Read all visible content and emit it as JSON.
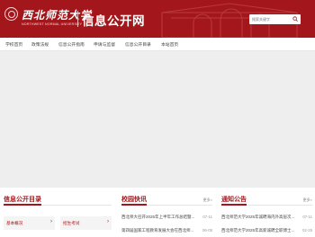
{
  "header": {
    "logo_cn": "西北师范大学",
    "logo_en": "NORTHWEST NORMAL UNIVERSITY",
    "site_title": "信息公开网",
    "search_placeholder": "搜索关键字"
  },
  "nav": {
    "items": [
      {
        "label": "学校首页"
      },
      {
        "label": "政策法规"
      },
      {
        "label": "信息公开指南"
      },
      {
        "label": "申请与监督"
      },
      {
        "label": "信息公开目录"
      },
      {
        "label": "本站首页"
      }
    ]
  },
  "sections": {
    "directory": {
      "title": "信息公开目录",
      "categories": [
        {
          "label": "基本概况"
        },
        {
          "label": "招生考试"
        }
      ]
    },
    "campus_news": {
      "title": "校园快讯",
      "more": "更多>",
      "items": [
        {
          "title": "西北师大召开2025年上半年工作总结暨...",
          "date": "07-11"
        },
        {
          "title": "第四届国家工程教育发展大会在西北师...",
          "date": "06-05"
        }
      ]
    },
    "notices": {
      "title": "通知公告",
      "more": "更多>",
      "items": [
        {
          "title": "西北师范大学2025年诚聘海内外高层次...",
          "date": "07-11"
        },
        {
          "title": "西北师范大学2025年高新诚聘全职博士...",
          "date": "02-25"
        }
      ]
    }
  },
  "colors": {
    "brand_red": "#a3161b",
    "banner_gray": "#eeeeee"
  }
}
